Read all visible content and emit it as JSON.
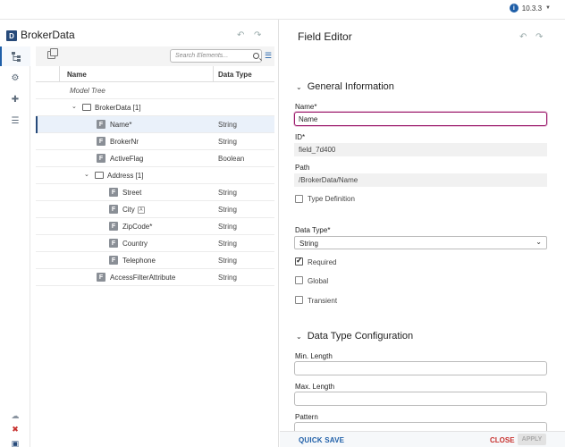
{
  "topbar": {
    "version": "10.3.3"
  },
  "left": {
    "logo": "D",
    "title": "BrokerData",
    "search_placeholder": "Search Elements...",
    "columns": [
      "Name",
      "Data Type"
    ],
    "root_label": "Model Tree",
    "rows": [
      {
        "name": "BrokerData [1]",
        "type": "",
        "kind": "folder"
      },
      {
        "name": "Name*",
        "type": "String",
        "kind": "field"
      },
      {
        "name": "BrokerNr",
        "type": "String",
        "kind": "field"
      },
      {
        "name": "ActiveFlag",
        "type": "Boolean",
        "kind": "field"
      },
      {
        "name": "Address [1]",
        "type": "",
        "kind": "folder"
      },
      {
        "name": "Street",
        "type": "String",
        "kind": "field"
      },
      {
        "name": "City",
        "type": "String",
        "kind": "field"
      },
      {
        "name": "ZipCode*",
        "type": "String",
        "kind": "field"
      },
      {
        "name": "Country",
        "type": "String",
        "kind": "field"
      },
      {
        "name": "Telephone",
        "type": "String",
        "kind": "field"
      },
      {
        "name": "AccessFilterAttribute",
        "type": "String",
        "kind": "field"
      }
    ]
  },
  "editor": {
    "title": "Field Editor",
    "general_section": "General Information",
    "name_label": "Name*",
    "name_value": "Name",
    "id_label": "ID*",
    "id_value": "field_7d400",
    "path_label": "Path",
    "path_value": "/BrokerData/Name",
    "type_def_label": "Type Definition",
    "data_type_label": "Data Type*",
    "data_type_value": "String",
    "required_label": "Required",
    "global_label": "Global",
    "transient_label": "Transient",
    "config_section": "Data Type Configuration",
    "min_length_label": "Min. Length",
    "max_length_label": "Max. Length",
    "pattern_label": "Pattern",
    "quick_save": "QUICK SAVE",
    "close": "CLOSE",
    "apply": "APPLY"
  },
  "colors": {
    "accent": "#1f5fa8",
    "focus": "#9b1b6b",
    "danger": "#c8322f"
  }
}
